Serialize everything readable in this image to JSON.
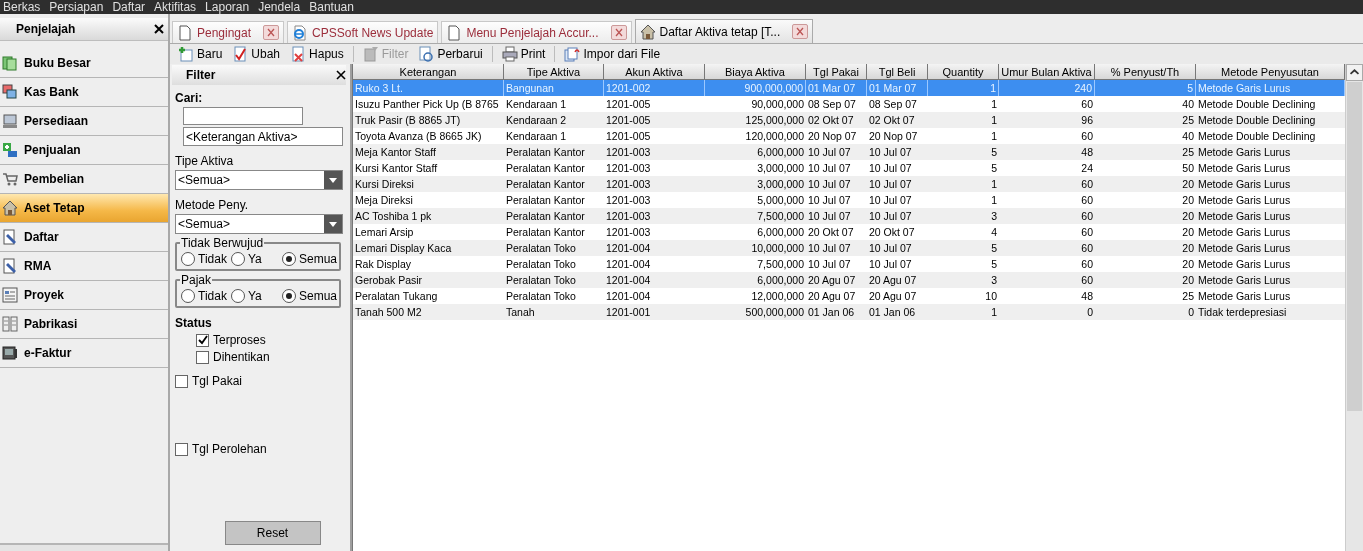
{
  "menu_bar": [
    "Berkas",
    "Persiapan",
    "Daftar",
    "Aktifitas",
    "Laporan",
    "Jendela",
    "Bantuan"
  ],
  "sidebar": {
    "title": "Penjelajah",
    "items": [
      {
        "label": "Buku Besar",
        "selected": false
      },
      {
        "label": "Kas Bank",
        "selected": false
      },
      {
        "label": "Persediaan",
        "selected": false
      },
      {
        "label": "Penjualan",
        "selected": false
      },
      {
        "label": "Pembelian",
        "selected": false
      },
      {
        "label": "Aset Tetap",
        "selected": true
      },
      {
        "label": "Daftar",
        "selected": false
      },
      {
        "label": "RMA",
        "selected": false
      },
      {
        "label": "Proyek",
        "selected": false
      },
      {
        "label": "Pabrikasi",
        "selected": false
      },
      {
        "label": "e-Faktur",
        "selected": false
      }
    ]
  },
  "tabs": [
    {
      "label": "Pengingat",
      "closable": true,
      "selected": false
    },
    {
      "label": "CPSSoft News Update",
      "closable": false,
      "selected": false
    },
    {
      "label": "Menu Penjelajah Accur...",
      "closable": true,
      "selected": false
    },
    {
      "label": "Daftar Aktiva tetap [T...",
      "closable": true,
      "selected": true
    }
  ],
  "toolbar": [
    [
      {
        "label": "Baru",
        "disabled": false
      },
      {
        "label": "Ubah",
        "disabled": false
      },
      {
        "label": "Hapus",
        "disabled": false
      }
    ],
    [
      {
        "label": "Filter",
        "disabled": true
      },
      {
        "label": "Perbarui",
        "disabled": false
      }
    ],
    [
      {
        "label": "Print",
        "disabled": false
      }
    ],
    [
      {
        "label": "Impor dari File",
        "disabled": false
      }
    ]
  ],
  "filter": {
    "title": "Filter",
    "search_label": "Cari:",
    "search_field": "<Keterangan Aktiva>",
    "combos": [
      {
        "label": "Tipe Aktiva",
        "value": "<Semua>"
      },
      {
        "label": "Metode Peny.",
        "value": "<Semua>"
      }
    ],
    "radio_groups": [
      {
        "title": "Tidak Berwujud",
        "options": [
          {
            "label": "Tidak",
            "selected": false
          },
          {
            "label": "Ya",
            "selected": false
          },
          {
            "label": "Semua",
            "selected": true
          }
        ]
      },
      {
        "title": "Pajak",
        "options": [
          {
            "label": "Tidak",
            "selected": false
          },
          {
            "label": "Ya",
            "selected": false
          },
          {
            "label": "Semua",
            "selected": true
          }
        ]
      }
    ],
    "status_title": "Status",
    "status": [
      {
        "label": "Terproses",
        "checked": true
      },
      {
        "label": "Dihentikan",
        "checked": false
      }
    ],
    "dates": [
      {
        "label": "Tgl Pakai",
        "checked": false
      },
      {
        "label": "Tgl Perolehan",
        "checked": false
      }
    ],
    "reset": "Reset"
  },
  "table": {
    "columns": [
      "Keterangan",
      "Tipe Aktiva",
      "Akun Aktiva",
      "Biaya Aktiva",
      "Tgl Pakai",
      "Tgl Beli",
      "Quantity",
      "Umur Bulan Aktiva",
      "% Penyust/Th",
      "Metode Penyusutan"
    ],
    "rows": [
      {
        "selected": true,
        "cells": [
          "Ruko 3 Lt.",
          "Bangunan",
          "1201-002",
          "900,000,000",
          "01 Mar 07",
          "01 Mar 07",
          "1",
          "240",
          "5",
          "Metode Garis Lurus"
        ]
      },
      {
        "selected": false,
        "cells": [
          "Isuzu Panther Pick Up (B 8765",
          "Kendaraan 1",
          "1201-005",
          "90,000,000",
          "08 Sep 07",
          "08 Sep 07",
          "1",
          "60",
          "40",
          "Metode Double Declining"
        ]
      },
      {
        "selected": false,
        "cells": [
          "Truk Pasir (B 8865 JT)",
          "Kendaraan 2",
          "1201-005",
          "125,000,000",
          "02 Okt 07",
          "02 Okt 07",
          "1",
          "96",
          "25",
          "Metode Double Declining"
        ]
      },
      {
        "selected": false,
        "cells": [
          "Toyota Avanza (B 8665 JK)",
          "Kendaraan 1",
          "1201-005",
          "120,000,000",
          "20 Nop 07",
          "20 Nop 07",
          "1",
          "60",
          "40",
          "Metode Double Declining"
        ]
      },
      {
        "selected": false,
        "cells": [
          "Meja Kantor Staff",
          "Peralatan Kantor",
          "1201-003",
          "6,000,000",
          "10 Jul 07",
          "10 Jul 07",
          "5",
          "48",
          "25",
          "Metode Garis Lurus"
        ]
      },
      {
        "selected": false,
        "cells": [
          "Kursi Kantor Staff",
          "Peralatan Kantor",
          "1201-003",
          "3,000,000",
          "10 Jul 07",
          "10 Jul 07",
          "5",
          "24",
          "50",
          "Metode Garis Lurus"
        ]
      },
      {
        "selected": false,
        "cells": [
          "Kursi Direksi",
          "Peralatan Kantor",
          "1201-003",
          "3,000,000",
          "10 Jul 07",
          "10 Jul 07",
          "1",
          "60",
          "20",
          "Metode Garis Lurus"
        ]
      },
      {
        "selected": false,
        "cells": [
          "Meja Direksi",
          "Peralatan Kantor",
          "1201-003",
          "5,000,000",
          "10 Jul 07",
          "10 Jul 07",
          "1",
          "60",
          "20",
          "Metode Garis Lurus"
        ]
      },
      {
        "selected": false,
        "cells": [
          "AC Toshiba 1 pk",
          "Peralatan Kantor",
          "1201-003",
          "7,500,000",
          "10 Jul 07",
          "10 Jul 07",
          "3",
          "60",
          "20",
          "Metode Garis Lurus"
        ]
      },
      {
        "selected": false,
        "cells": [
          "Lemari Arsip",
          "Peralatan Kantor",
          "1201-003",
          "6,000,000",
          "20 Okt 07",
          "20 Okt 07",
          "4",
          "60",
          "20",
          "Metode Garis Lurus"
        ]
      },
      {
        "selected": false,
        "cells": [
          "Lemari Display Kaca",
          "Peralatan Toko",
          "1201-004",
          "10,000,000",
          "10 Jul 07",
          "10 Jul 07",
          "5",
          "60",
          "20",
          "Metode Garis Lurus"
        ]
      },
      {
        "selected": false,
        "cells": [
          "Rak Display",
          "Peralatan Toko",
          "1201-004",
          "7,500,000",
          "10 Jul 07",
          "10 Jul 07",
          "5",
          "60",
          "20",
          "Metode Garis Lurus"
        ]
      },
      {
        "selected": false,
        "cells": [
          "Gerobak Pasir",
          "Peralatan Toko",
          "1201-004",
          "6,000,000",
          "20 Agu 07",
          "20 Agu 07",
          "3",
          "60",
          "20",
          "Metode Garis Lurus"
        ]
      },
      {
        "selected": false,
        "cells": [
          "Peralatan Tukang",
          "Peralatan Toko",
          "1201-004",
          "12,000,000",
          "20 Agu 07",
          "20 Agu 07",
          "10",
          "48",
          "25",
          "Metode Garis Lurus"
        ]
      },
      {
        "selected": false,
        "cells": [
          "Tanah 500 M2",
          "Tanah",
          "1201-001",
          "500,000,000",
          "01 Jan 06",
          "01 Jan 06",
          "1",
          "0",
          "0",
          "Tidak terdepresiasi"
        ]
      }
    ]
  }
}
